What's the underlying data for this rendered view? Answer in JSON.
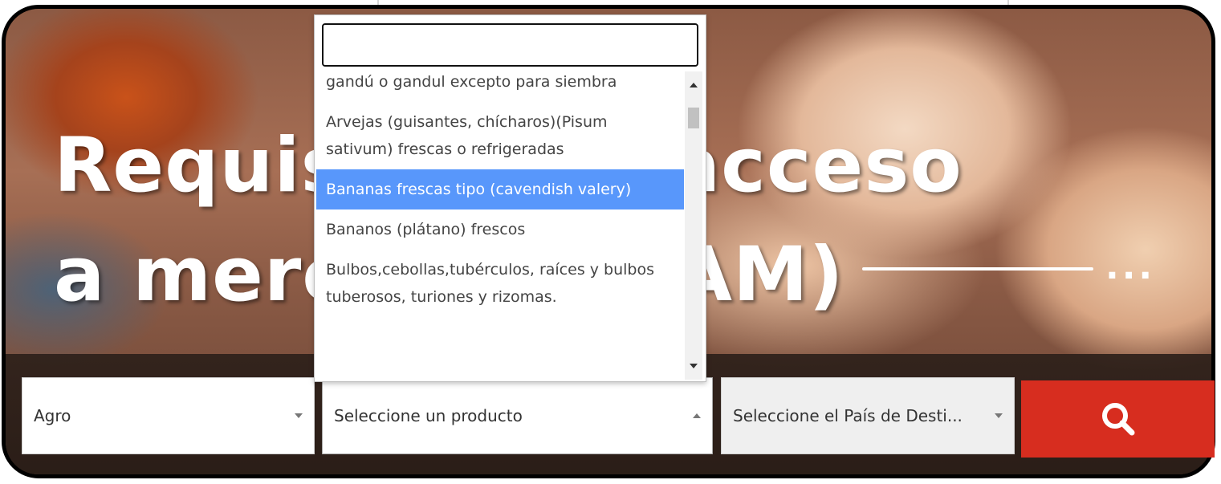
{
  "hero": {
    "title": "Requisitos de acceso\na mercados (RAM)",
    "dots": "..."
  },
  "filters": {
    "sector": {
      "value": "Agro"
    },
    "product": {
      "value": "Seleccione un producto"
    },
    "country": {
      "value": "Seleccione el País de Desti..."
    }
  },
  "dropdown": {
    "search_value": "",
    "items": [
      {
        "label": "gandú o gandul excepto para siembra"
      },
      {
        "label": "Arvejas (guisantes, chícharos)(Pisum sativum) frescas o refrigeradas"
      },
      {
        "label": "Bananas frescas tipo (cavendish valery)"
      },
      {
        "label": "Bananos (plátano) frescos"
      },
      {
        "label": "Bulbos,cebollas,tubérculos, raíces y bulbos tuberosos, turiones y rizomas."
      }
    ],
    "highlighted_index": 2
  },
  "colors": {
    "search_button": "#d72d1f",
    "highlight": "#5897fb"
  },
  "icons": {
    "search": "search-icon"
  }
}
